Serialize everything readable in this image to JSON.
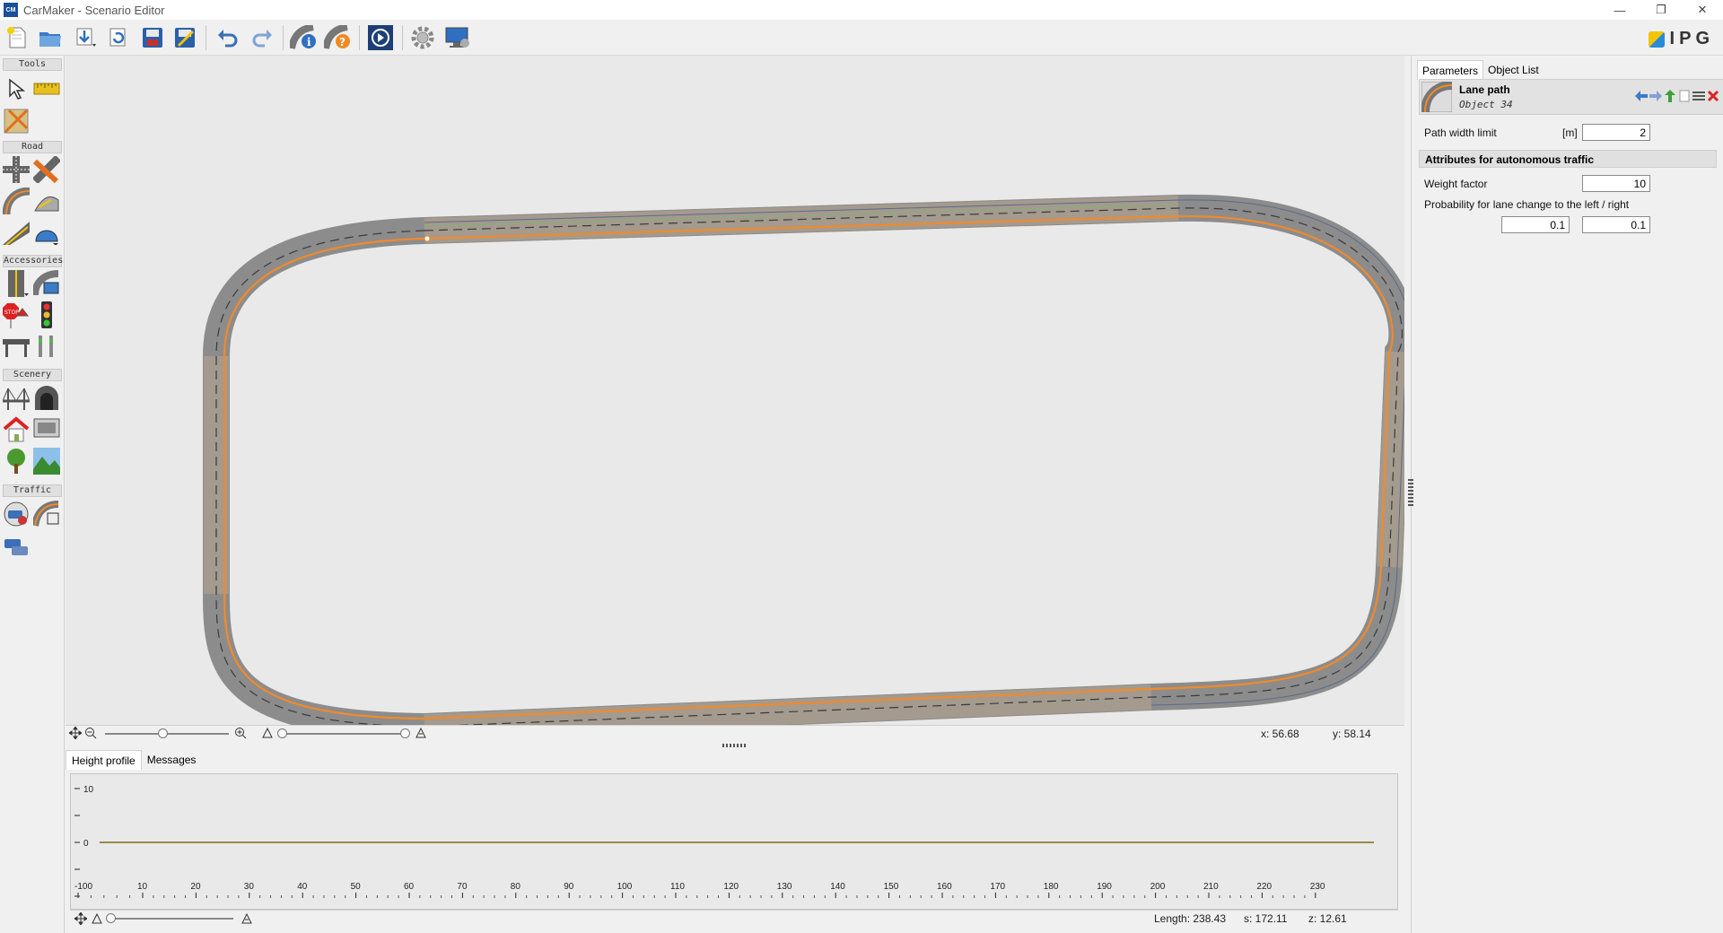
{
  "window": {
    "app_icon": "CM",
    "title": "CarMaker - Scenario Editor",
    "minimize": "—",
    "restore": "❐",
    "close": "✕"
  },
  "toolbar": {
    "buttons": [
      "new-file-icon",
      "open-folder-icon",
      "import-icon",
      "reload-icon",
      "save-icon",
      "save-as-icon",
      "undo-icon",
      "redo-icon",
      "road-info-icon",
      "road-check-icon",
      "play-icon",
      "settings-gear-icon",
      "display-settings-icon"
    ],
    "logo_text": "IPG"
  },
  "tools": {
    "sections": {
      "tools": "Tools",
      "road": "Road",
      "accessories": "Accessories",
      "scenery": "Scenery",
      "traffic": "Traffic"
    }
  },
  "canvas": {
    "coord_x": "x:  56.68",
    "coord_y": "y:  58.14"
  },
  "bottom": {
    "tabs": [
      "Height profile",
      "Messages"
    ],
    "y_ticks": [
      "10",
      "",
      "0",
      "",
      ""
    ],
    "x_ticks": [
      "-100",
      "10",
      "20",
      "30",
      "40",
      "50",
      "60",
      "70",
      "80",
      "90",
      "100",
      "110",
      "120",
      "130",
      "140",
      "150",
      "160",
      "170",
      "180",
      "190",
      "200",
      "210",
      "220",
      "230"
    ],
    "length": "Length: 238.43",
    "s": "s: 172.11",
    "z": "z: 12.61"
  },
  "panel": {
    "tabs": [
      "Parameters",
      "Object List"
    ],
    "object_title": "Lane path",
    "object_sub": "Object 34",
    "path_width_label": "Path width limit",
    "path_width_unit": "[m]",
    "path_width_value": "2",
    "section_title": "Attributes for autonomous traffic",
    "weight_label": "Weight factor",
    "weight_value": "10",
    "prob_label": "Probability for lane change to the left / right",
    "prob_left": "0.1",
    "prob_right": "0.1"
  },
  "colors": {
    "road": "#8c8c8c",
    "path": "#f08a2c",
    "profile_line": "#7a6a10"
  }
}
